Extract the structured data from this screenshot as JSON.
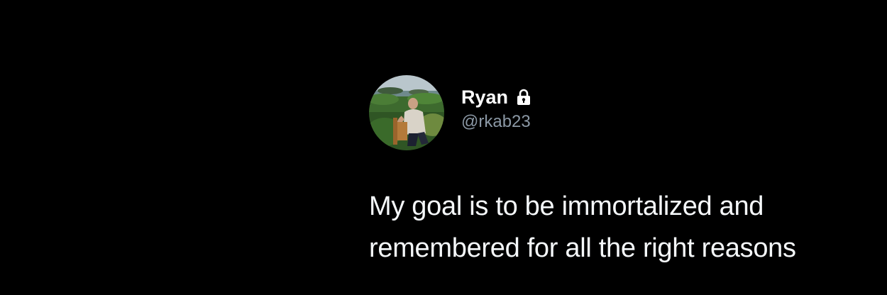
{
  "user": {
    "display_name": "Ryan",
    "handle": "@rkab23",
    "protected_icon": "lock-icon",
    "avatar": "profile-photo"
  },
  "tweet": {
    "lines": [
      "My goal is to be immortalized and",
      "remembered for all the right reasons"
    ]
  },
  "colors": {
    "background": "#000000",
    "name": "#ffffff",
    "handle": "#8b98a5",
    "text": "#f5f8fa"
  }
}
